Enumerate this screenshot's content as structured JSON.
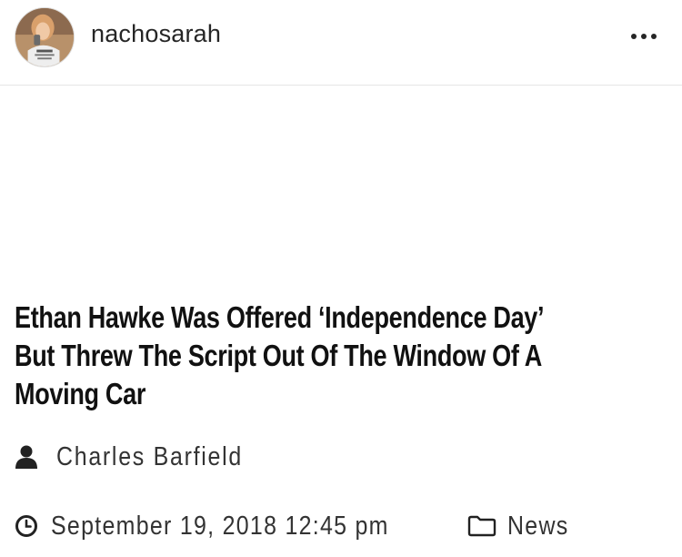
{
  "header": {
    "username": "nachosarah",
    "more_icon": "ellipsis-icon"
  },
  "post": {
    "headline": "Ethan Hawke Was Offered ‘Independence Day’ But Threw The Script Out Of The Window Of A Moving Car",
    "author": "Charles Barfield",
    "author_icon": "user-icon",
    "date": "September 19, 2018 12:45 pm",
    "date_icon": "clock-icon",
    "category": "News",
    "category_icon": "folder-icon"
  }
}
